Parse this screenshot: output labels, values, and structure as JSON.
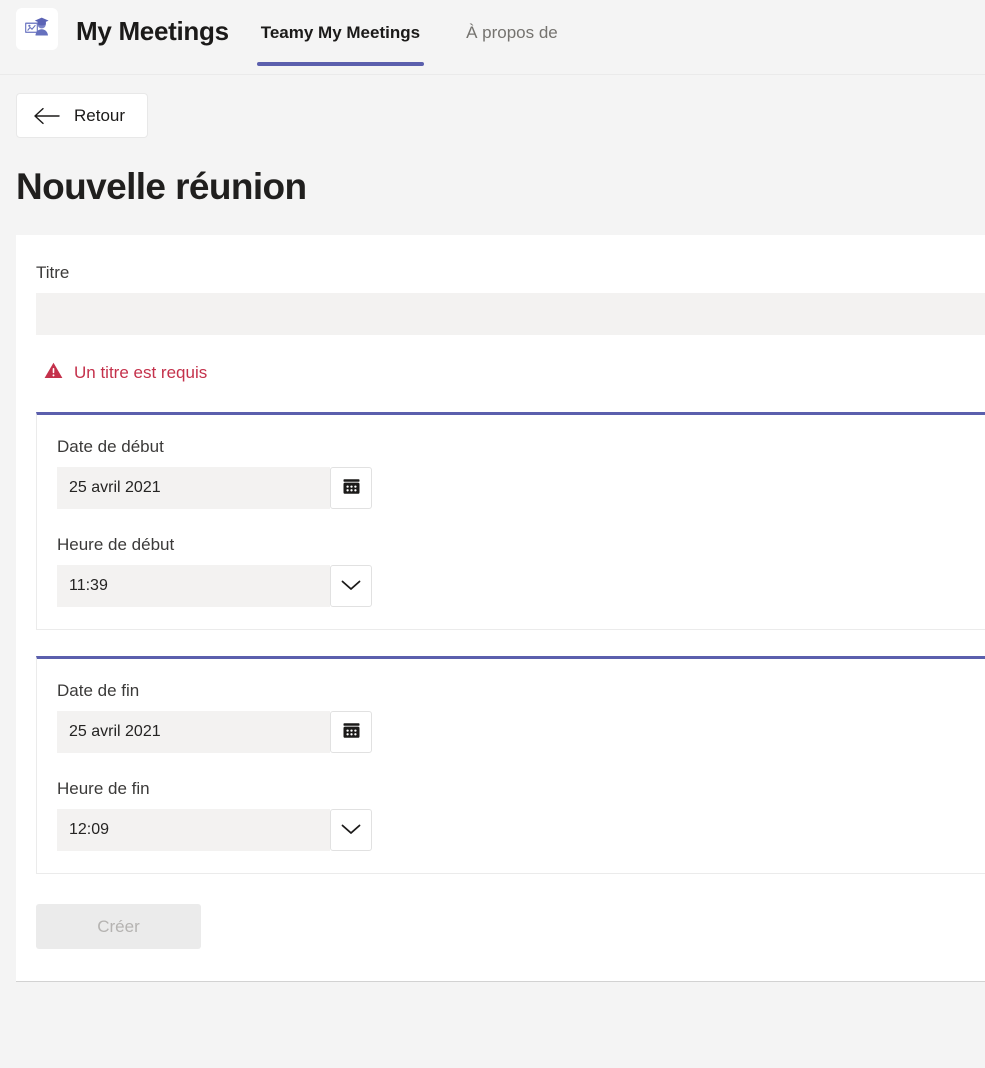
{
  "header": {
    "app_title": "My Meetings",
    "logo_icon": "graduate-presenter-icon",
    "tabs": [
      {
        "label": "Teamy My Meetings",
        "active": true
      },
      {
        "label": "À propos de",
        "active": false
      }
    ],
    "accent_color": "#5b5fad"
  },
  "back": {
    "label": "Retour",
    "icon": "arrow-left-icon"
  },
  "page": {
    "title": "Nouvelle réunion"
  },
  "form": {
    "title_field": {
      "label": "Titre",
      "value": "",
      "placeholder": ""
    },
    "error": {
      "icon": "warning-triangle-icon",
      "message": "Un titre est requis",
      "color": "#c4314b"
    },
    "start_section": {
      "date": {
        "label": "Date de début",
        "value": "25 avril 2021",
        "button_icon": "calendar-icon"
      },
      "time": {
        "label": "Heure de début",
        "value": "11:39",
        "button_icon": "chevron-down-icon"
      }
    },
    "end_section": {
      "date": {
        "label": "Date de fin",
        "value": "25 avril 2021",
        "button_icon": "calendar-icon"
      },
      "time": {
        "label": "Heure de fin",
        "value": "12:09",
        "button_icon": "chevron-down-icon"
      }
    },
    "submit": {
      "label": "Créer",
      "disabled": true
    }
  }
}
